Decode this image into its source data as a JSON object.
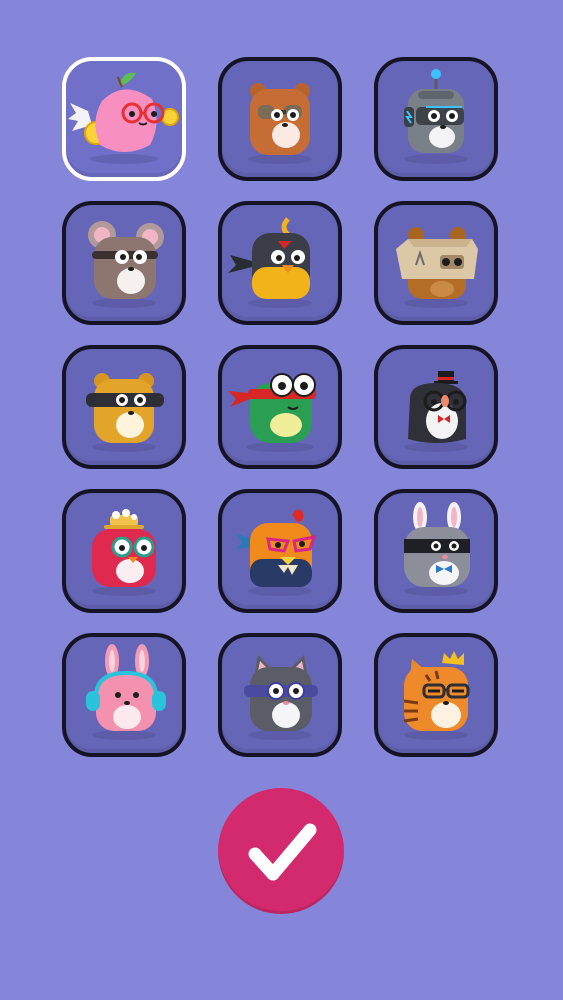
{
  "avatar_picker": {
    "selected_index": 0,
    "avatars": [
      {
        "id": "winged-peach",
        "icon": "winged-peach-icon"
      },
      {
        "id": "brown-bear",
        "icon": "brown-bear-icon"
      },
      {
        "id": "robot",
        "icon": "robot-icon"
      },
      {
        "id": "mouse",
        "icon": "mouse-icon"
      },
      {
        "id": "ninja-bird",
        "icon": "ninja-bird-icon"
      },
      {
        "id": "box-bear",
        "icon": "box-bear-icon"
      },
      {
        "id": "goggle-bear",
        "icon": "goggle-bear-icon"
      },
      {
        "id": "ninja-frog",
        "icon": "ninja-frog-icon"
      },
      {
        "id": "top-hat-penguin",
        "icon": "top-hat-penguin-icon"
      },
      {
        "id": "hat-bird",
        "icon": "hat-bird-icon"
      },
      {
        "id": "rooster",
        "icon": "rooster-icon"
      },
      {
        "id": "masked-bunny",
        "icon": "masked-bunny-icon"
      },
      {
        "id": "pink-bunny",
        "icon": "pink-bunny-icon"
      },
      {
        "id": "gray-cat",
        "icon": "gray-cat-icon"
      },
      {
        "id": "crowned-tiger",
        "icon": "crowned-tiger-icon"
      }
    ]
  },
  "confirm": {
    "icon": "checkmark-icon"
  },
  "colors": {
    "background": "#8585d9",
    "tile": "#6666b9",
    "tile_border": "#141425",
    "selected_border": "#ffffff",
    "confirm": "#d32a6d"
  }
}
